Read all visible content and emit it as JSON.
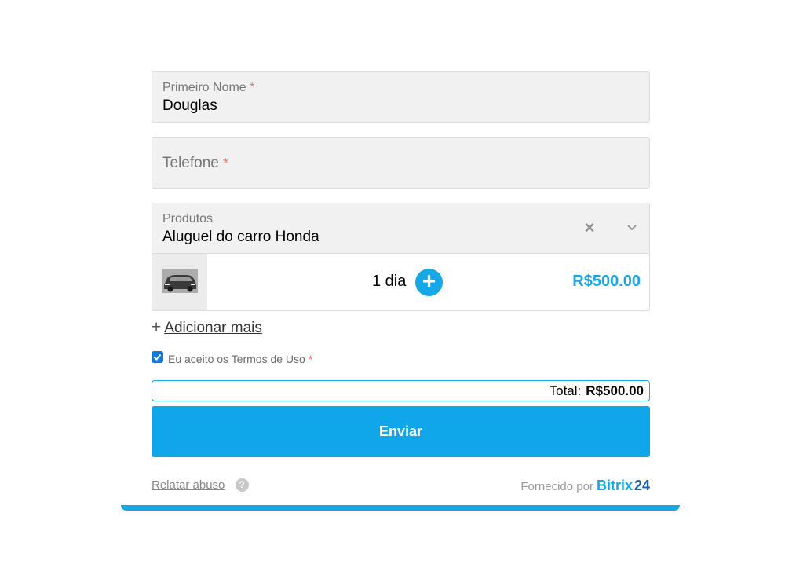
{
  "form": {
    "first_name": {
      "label": "Primeiro Nome",
      "required_mark": "*",
      "value": "Douglas"
    },
    "phone": {
      "placeholder": "Telefone",
      "required_mark": "*"
    },
    "products": {
      "label": "Produtos",
      "selected": "Aluguel do carro Honda",
      "clear_icon": "close-icon",
      "dropdown_icon": "chevron-down-icon",
      "item": {
        "thumbnail": "car-image",
        "quantity": "1 dia",
        "price": "R$500.00"
      }
    },
    "add_more": {
      "icon": "plus-icon",
      "label": "Adicionar mais"
    },
    "terms": {
      "label": "Eu aceito os Termos de Uso",
      "required_mark": "*",
      "checked": true
    },
    "total": {
      "label": "Total:",
      "value": "R$500.00"
    },
    "submit_label": "Enviar"
  },
  "footer": {
    "report_label": "Relatar abuso",
    "help_icon": "?",
    "powered_label": "Fornecido por",
    "brand_primary": "Bitrix",
    "brand_secondary": "24"
  },
  "colors": {
    "accent": "#16a7e6",
    "required": "#f26d5b",
    "field_bg": "#f1f1f1"
  }
}
